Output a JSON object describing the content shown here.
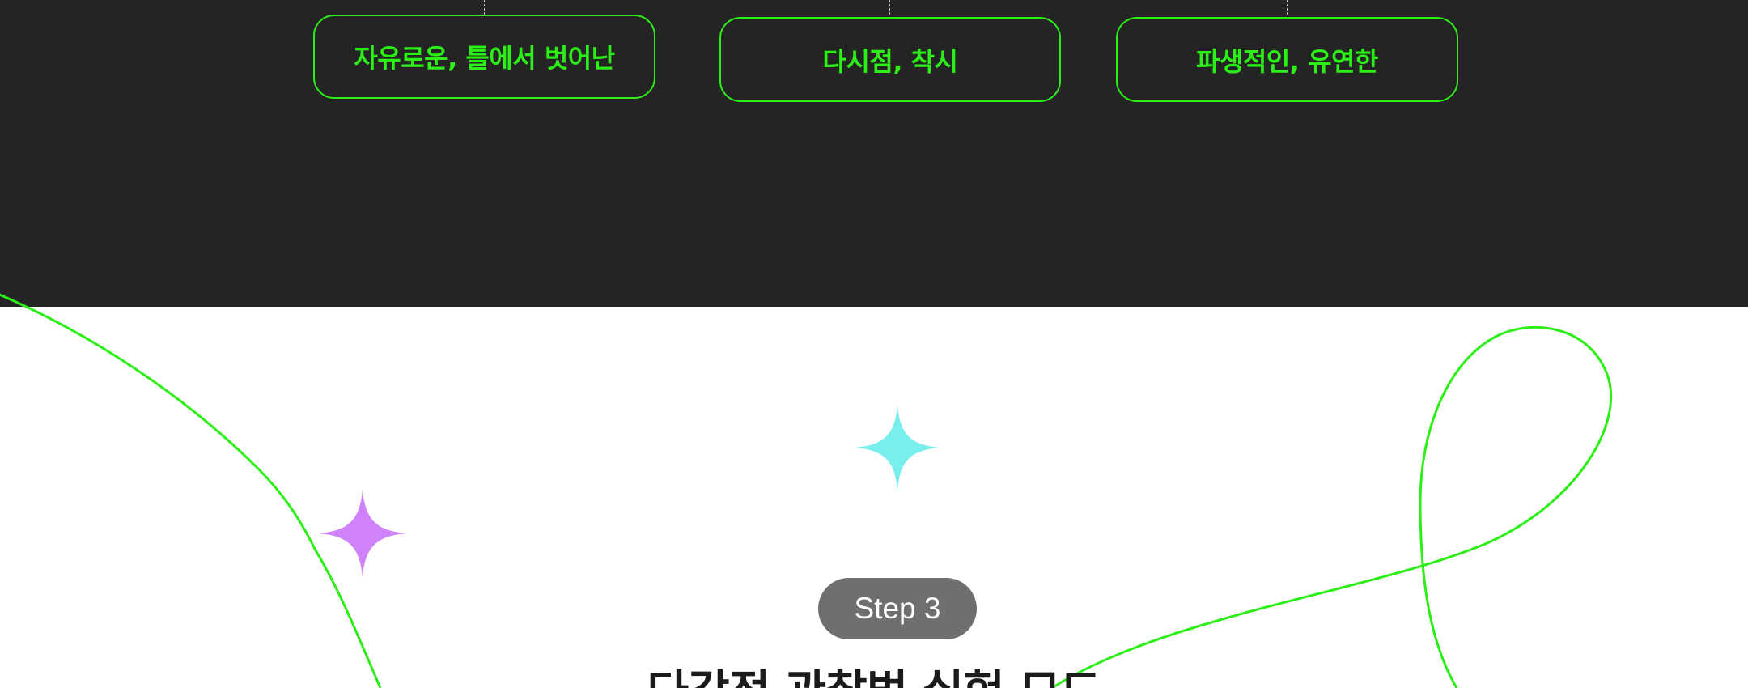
{
  "cards": [
    {
      "label": "자유로운, 틀에서 벗어난"
    },
    {
      "label": "다시점, 착시"
    },
    {
      "label": "파생적인, 유연한"
    }
  ],
  "step": {
    "label": "Step 3"
  },
  "heading": {
    "text": "다각적 관찰법 실험 모드"
  },
  "colors": {
    "dark_background": "#242424",
    "accent_green": "#2bef16",
    "sparkle_cyan": "#78efec",
    "sparkle_purple": "#cf82f9",
    "badge_gray": "#6f6f6f"
  },
  "icons": [
    "sparkle-purple-icon",
    "sparkle-cyan-icon"
  ]
}
